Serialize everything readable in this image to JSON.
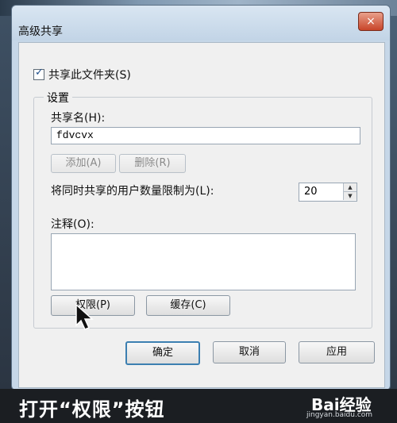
{
  "dialog": {
    "title": "高级共享",
    "close_icon": "×",
    "share_folder_checkbox": {
      "label": "共享此文件夹(S)",
      "checked": true
    },
    "settings_group_title": "设置",
    "share_name_label": "共享名(H):",
    "share_name_value": "fdvcvx",
    "add_button": "添加(A)",
    "remove_button": "删除(R)",
    "user_limit_label": "将同时共享的用户数量限制为(L):",
    "user_limit_value": "20",
    "notes_label": "注释(O):",
    "notes_value": "",
    "permissions_button": "权限(P)",
    "cache_button": "缓存(C)",
    "ok_button": "确定",
    "cancel_button": "取消",
    "apply_button": "应用"
  },
  "caption": "打开“权限”按钮",
  "watermark": {
    "logo": "Bai经验",
    "url": "jingyan.baidu.com"
  }
}
